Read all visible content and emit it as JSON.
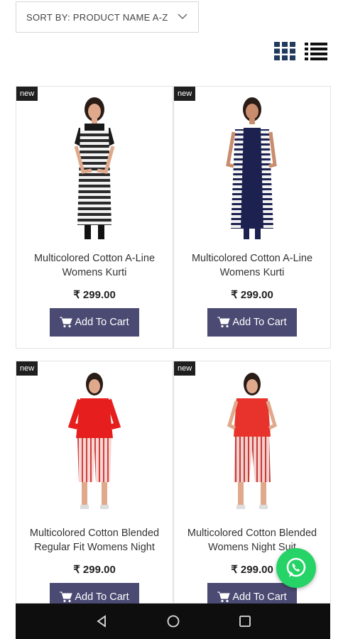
{
  "sort": {
    "label": "SORT BY: PRODUCT NAME A-Z"
  },
  "products": [
    {
      "badge": "new",
      "name": "Multicolored Cotton A-Line Womens Kurti",
      "price": "₹ 299.00",
      "button": "Add To Cart"
    },
    {
      "badge": "new",
      "name": "Multicolored Cotton A-Line Womens Kurti",
      "price": "₹ 299.00",
      "button": "Add To Cart"
    },
    {
      "badge": "new",
      "name": "Multicolored Cotton Blended Regular Fit Womens Night",
      "price": "₹ 299.00",
      "button": "Add To Cart"
    },
    {
      "badge": "new",
      "name": "Multicolored Cotton Blended Womens Night Suit",
      "price": "₹ 299.00",
      "button": "Add To Cart"
    }
  ],
  "colors": {
    "button": "#4b4a73",
    "icon": "#1f3a5c",
    "whatsapp": "#25d366"
  },
  "icons": [
    "chevron-down-icon",
    "grid-view-icon",
    "list-view-icon",
    "cart-icon",
    "whatsapp-icon",
    "back-icon",
    "home-icon",
    "recents-icon"
  ]
}
